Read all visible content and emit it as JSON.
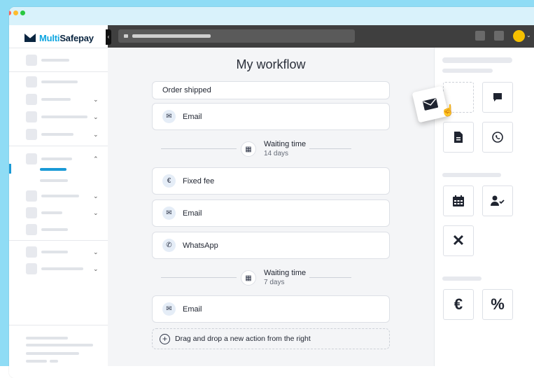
{
  "brand": {
    "name_part1": "Multi",
    "name_part2": "Safepay"
  },
  "workflow": {
    "title": "My workflow",
    "trigger": "Order shipped",
    "steps": [
      {
        "label": "Email",
        "icon": "envelope-icon"
      },
      {
        "label": "Fixed fee",
        "icon": "euro-icon"
      },
      {
        "label": "Email",
        "icon": "envelope-icon"
      },
      {
        "label": "WhatsApp",
        "icon": "whatsapp-icon"
      },
      {
        "label": "Email",
        "icon": "envelope-icon"
      }
    ],
    "waits": [
      {
        "title": "Waiting time",
        "duration": "14 days"
      },
      {
        "title": "Waiting time",
        "duration": "7 days"
      }
    ],
    "dropzone": "Drag and drop a new action from the right"
  },
  "palette": {
    "groups": [
      {
        "tiles": [
          "email-tile-dragged-placeholder",
          "chat-bubble-icon",
          "document-icon",
          "whatsapp-icon"
        ]
      },
      {
        "tiles": [
          "calendar-icon",
          "user-check-icon",
          "x-icon"
        ]
      },
      {
        "tiles": [
          "euro-icon",
          "percent-icon"
        ]
      }
    ],
    "glyphs": {
      "euro": "€",
      "percent": "%",
      "x": "✕"
    }
  },
  "colors": {
    "accent": "#1a9ad6",
    "avatar": "#f5c000",
    "brand_dark": "#0a2540"
  }
}
